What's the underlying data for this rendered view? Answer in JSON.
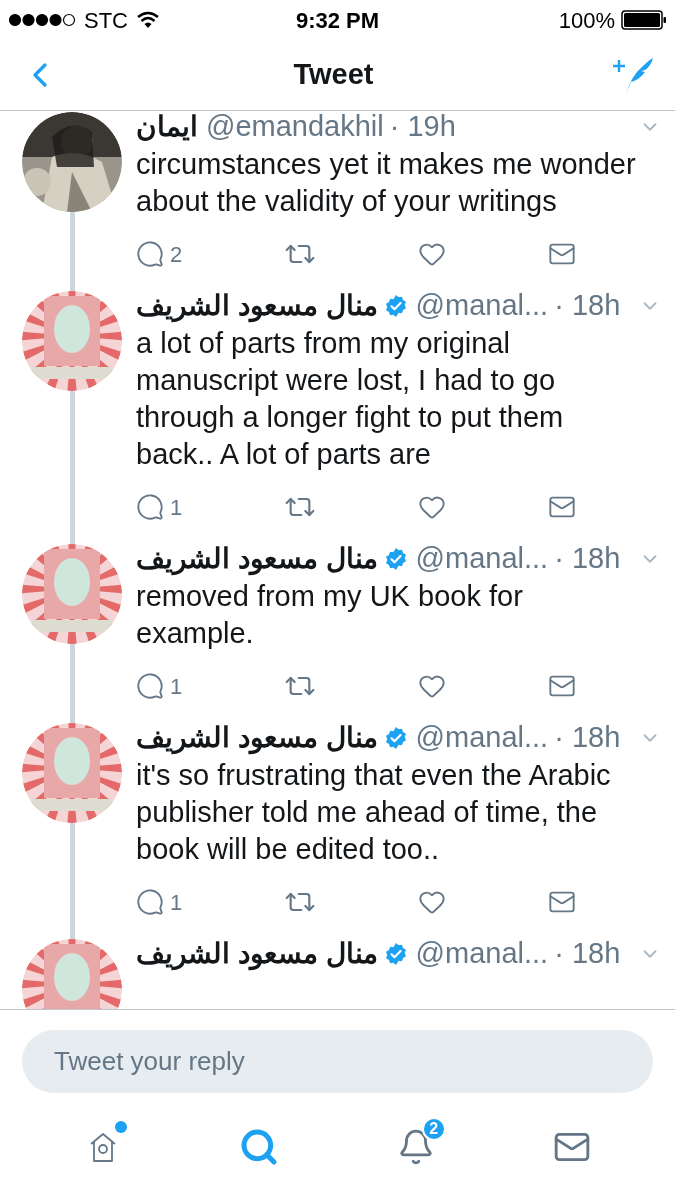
{
  "status_bar": {
    "carrier": "STC",
    "time": "9:32 PM",
    "battery": "100%"
  },
  "nav": {
    "title": "Tweet"
  },
  "tweets": [
    {
      "name": "ايمان",
      "handle": "@emandakhil",
      "time": "· 19h",
      "verified": false,
      "text": "circumstances yet it makes me wonder about the validity of your writings",
      "replies": "2"
    },
    {
      "name": "منال مسعود الشريف",
      "handle": "@manal...",
      "time": "· 18h",
      "verified": true,
      "text": "a lot of parts from my original manuscript were lost, I had to go through a longer fight to put them back.. A lot of parts are",
      "replies": "1"
    },
    {
      "name": "منال مسعود الشريف",
      "handle": "@manal...",
      "time": "· 18h",
      "verified": true,
      "text": "removed from my UK book for example.",
      "replies": "1"
    },
    {
      "name": "منال مسعود الشريف",
      "handle": "@manal...",
      "time": "· 18h",
      "verified": true,
      "text": "it's so frustrating that even the Arabic publisher told me ahead of time, the book will be edited too..",
      "replies": "1"
    },
    {
      "name": "منال مسعود الشريف",
      "handle": "@manal...",
      "time": "· 18h",
      "verified": true
    }
  ],
  "reply": {
    "placeholder": "Tweet your reply"
  },
  "tabs": [
    {
      "kind": "home",
      "selected": false,
      "dot": true
    },
    {
      "kind": "search",
      "selected": true,
      "dot": false
    },
    {
      "kind": "notifications",
      "selected": false,
      "dot": false,
      "badge": "2"
    },
    {
      "kind": "messages",
      "selected": false,
      "dot": false
    }
  ]
}
